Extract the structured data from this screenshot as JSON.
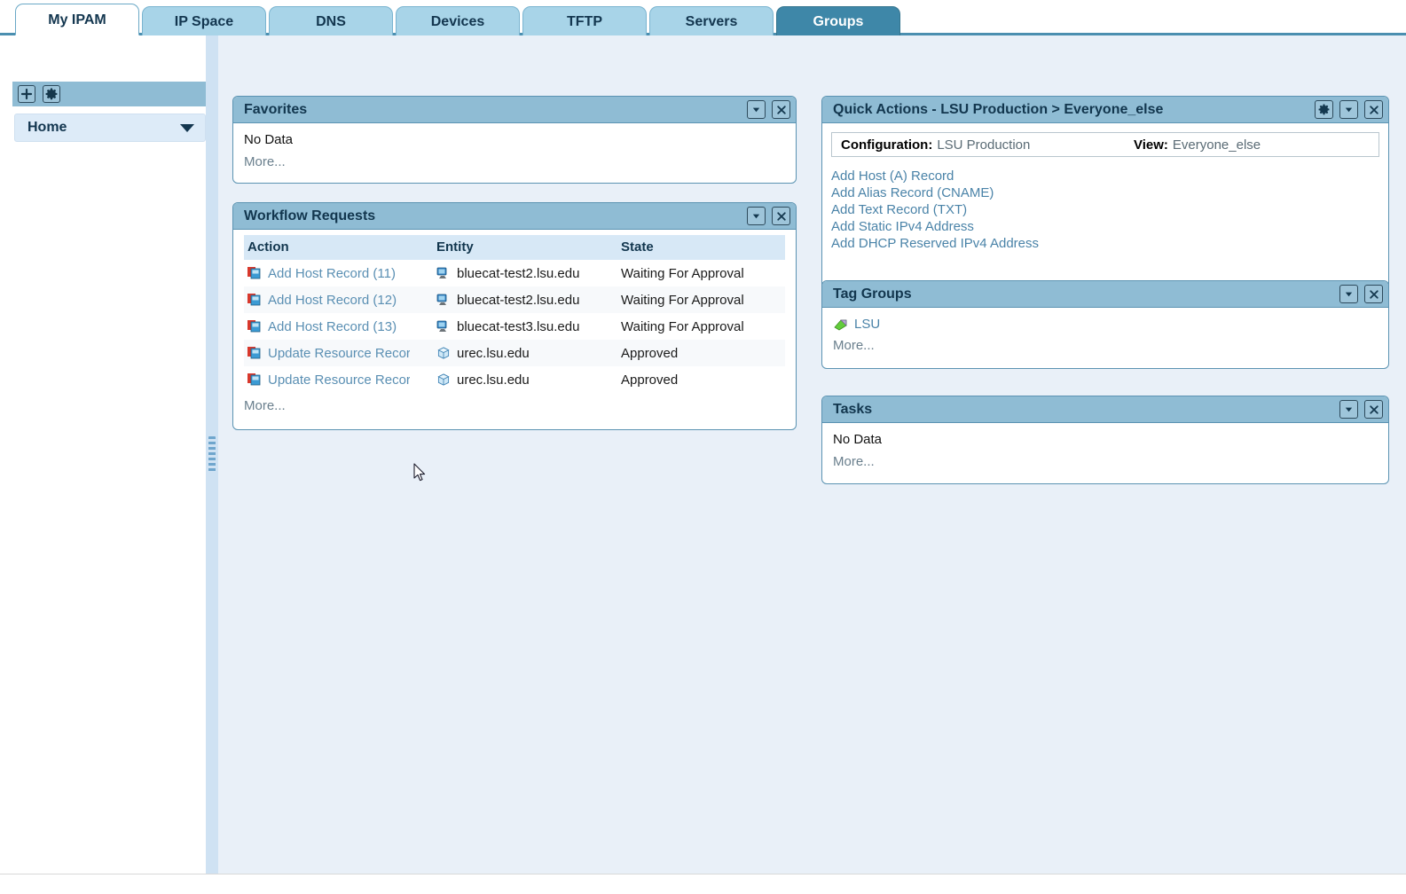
{
  "tabs": [
    {
      "label": "My IPAM",
      "state": "active"
    },
    {
      "label": "IP Space",
      "state": "normal"
    },
    {
      "label": "DNS",
      "state": "normal"
    },
    {
      "label": "Devices",
      "state": "normal"
    },
    {
      "label": "TFTP",
      "state": "normal"
    },
    {
      "label": "Servers",
      "state": "normal"
    },
    {
      "label": "Groups",
      "state": "hover"
    }
  ],
  "sidebar": {
    "add_button_icon": "plus-icon",
    "settings_button_icon": "gear-icon",
    "selector_value": "Home"
  },
  "panels": {
    "favorites": {
      "title": "Favorites",
      "empty_text": "No Data",
      "more_label": "More..."
    },
    "workflow": {
      "title": "Workflow Requests",
      "columns": [
        "Action",
        "Entity",
        "State"
      ],
      "rows": [
        {
          "action": "Add Host Record (11)",
          "entity": "bluecat-test2.lsu.edu",
          "state": "Waiting For Approval",
          "action_icon": "workflow-record-icon",
          "entity_icon": "host-icon"
        },
        {
          "action": "Add Host Record (12)",
          "entity": "bluecat-test2.lsu.edu",
          "state": "Waiting For Approval",
          "action_icon": "workflow-record-icon",
          "entity_icon": "host-icon"
        },
        {
          "action": "Add Host Record (13)",
          "entity": "bluecat-test3.lsu.edu",
          "state": "Waiting For Approval",
          "action_icon": "workflow-record-icon",
          "entity_icon": "host-icon"
        },
        {
          "action": "Update Resource Record",
          "entity": "urec.lsu.edu",
          "state": "Approved",
          "action_icon": "workflow-record-icon",
          "entity_icon": "resource-record-icon"
        },
        {
          "action": "Update Resource Record",
          "entity": "urec.lsu.edu",
          "state": "Approved",
          "action_icon": "workflow-record-icon",
          "entity_icon": "resource-record-icon"
        }
      ],
      "more_label": "More..."
    },
    "quick_actions": {
      "title": "Quick Actions - LSU Production > Everyone_else",
      "configuration_label": "Configuration:",
      "configuration_value": "LSU Production",
      "view_label": "View:",
      "view_value": "Everyone_else",
      "links": [
        "Add Host (A) Record",
        "Add Alias Record (CNAME)",
        "Add Text Record (TXT)",
        "Add Static IPv4 Address",
        "Add DHCP Reserved IPv4 Address"
      ]
    },
    "tag_groups": {
      "title": "Tag Groups",
      "items": [
        {
          "label": "LSU",
          "icon": "tag-icon"
        }
      ],
      "more_label": "More..."
    },
    "tasks": {
      "title": "Tasks",
      "empty_text": "No Data",
      "more_label": "More..."
    }
  },
  "colors": {
    "panel_header": "#8fbcd4",
    "panel_border": "#5b93b2",
    "tab_inactive": "#a8d4e8",
    "tab_hover": "#3e87a8",
    "main_bg": "#e9f0f8",
    "link": "#4a83a8",
    "table_header": "#d7e8f6"
  }
}
